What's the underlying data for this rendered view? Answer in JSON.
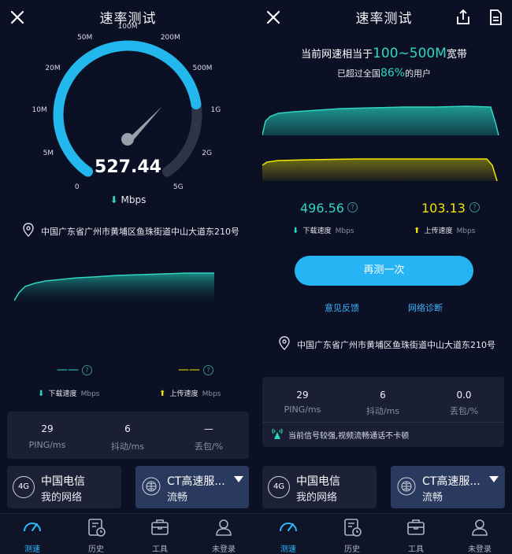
{
  "left": {
    "title": "速率测试",
    "gauge": {
      "ticks": [
        "0",
        "5M",
        "10M",
        "20M",
        "50M",
        "100M",
        "200M",
        "500M",
        "1G",
        "2G",
        "5G"
      ],
      "speed": "527.44",
      "unit": "Mbps",
      "fill_fraction": 0.78
    },
    "location": "中国广东省广州市黄埔区鱼珠街道中山大道东210号",
    "download": {
      "value": "——",
      "label": "下载速度",
      "unit": "Mbps"
    },
    "upload": {
      "value": "——",
      "label": "上传速度",
      "unit": "Mbps"
    },
    "stats": [
      {
        "value": "29",
        "label": "PING/ms"
      },
      {
        "value": "6",
        "label": "抖动/ms"
      },
      {
        "value": "—",
        "label": "丢包/%"
      }
    ],
    "isp": {
      "badge": "4G",
      "name": "中国电信",
      "sub": "我的网络"
    },
    "service": {
      "name": "CT高速服...",
      "sub": "流畅"
    }
  },
  "right": {
    "title": "速率测试",
    "headline_prefix": "当前网速相当于",
    "headline_value": "100~500M",
    "headline_suffix": "宽带",
    "sub_prefix": "已超过全国",
    "sub_value": "86%",
    "sub_suffix": "的用户",
    "download": {
      "value": "496.56",
      "label": "下载速度",
      "unit": "Mbps"
    },
    "upload": {
      "value": "103.13",
      "label": "上传速度",
      "unit": "Mbps"
    },
    "retest": "再测一次",
    "feedback": "意见反馈",
    "diagnose": "网络诊断",
    "location": "中国广东省广州市黄埔区鱼珠街道中山大道东210号",
    "stats": [
      {
        "value": "29",
        "label": "PING/ms"
      },
      {
        "value": "6",
        "label": "抖动/ms"
      },
      {
        "value": "0.0",
        "label": "丢包/%"
      }
    ],
    "signal_note": "当前信号较强,视频流畅通话不卡顿",
    "isp": {
      "badge": "4G",
      "name": "中国电信",
      "sub": "我的网络"
    },
    "service": {
      "name": "CT高速服...",
      "sub": "流畅"
    }
  },
  "nav": [
    {
      "label": "测速",
      "icon": "speedometer-icon",
      "active": true
    },
    {
      "label": "历史",
      "icon": "history-icon",
      "active": false
    },
    {
      "label": "工具",
      "icon": "toolbox-icon",
      "active": false
    },
    {
      "label": "未登录",
      "icon": "user-icon",
      "active": false
    }
  ],
  "colors": {
    "accent": "#27b4f5",
    "download": "#2fd6c2",
    "upload": "#f2e600",
    "background": "#0b1024"
  }
}
